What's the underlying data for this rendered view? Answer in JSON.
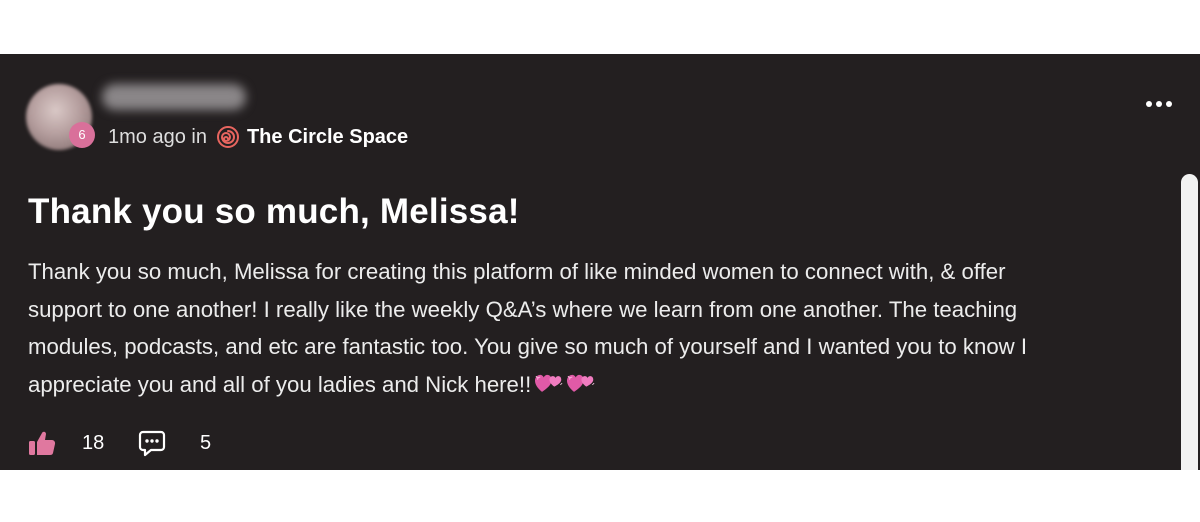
{
  "author": {
    "level": "6",
    "avatar_icon": "blurred-avatar",
    "name_hidden": true
  },
  "meta": {
    "time": "1mo ago in",
    "space_icon": "spiral-icon",
    "space_name": "The Circle Space"
  },
  "post": {
    "title": "Thank you so much, Melissa!",
    "body_lines": [
      "Thank you so much, Melissa for creating this platform of like minded women to connect with, & offer",
      "support to one another! I really like the weekly Q&A’s where we learn from one another. The teaching",
      "modules, podcasts, and etc are fantastic too. You give so much of yourself and I wanted you to know I",
      "appreciate you and all of you ladies and Nick here!!"
    ],
    "emoji": "two-hearts-emoji"
  },
  "actions": {
    "like_icon": "thumbs-up-icon",
    "like_count": "18",
    "comment_icon": "comment-icon",
    "comment_count": "5"
  },
  "colors": {
    "background": "#231f20",
    "accent_pink": "#d9709a",
    "text": "#ffffff"
  }
}
